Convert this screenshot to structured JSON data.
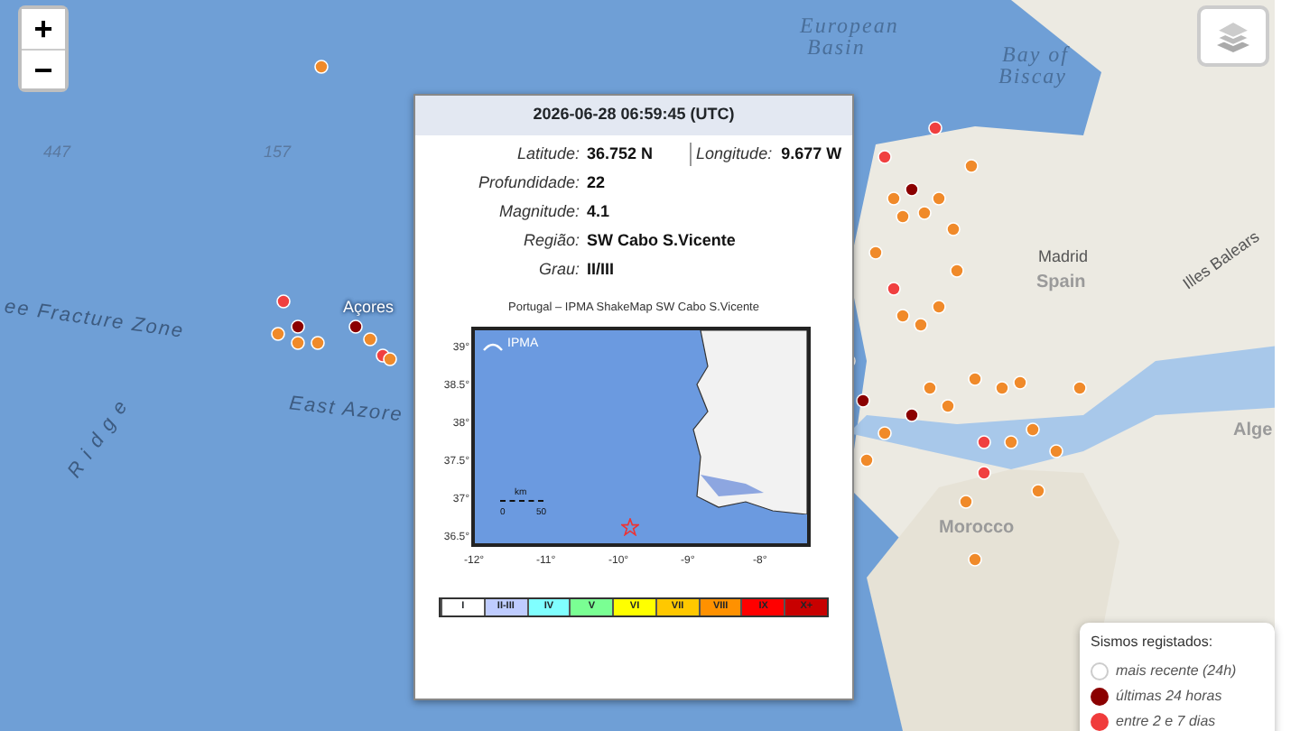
{
  "map": {
    "labels": [
      {
        "text": "European",
        "kind": "sea"
      },
      {
        "text": "Basin",
        "kind": "sea"
      },
      {
        "text": "Bay of",
        "kind": "sea"
      },
      {
        "text": "Biscay",
        "kind": "sea"
      },
      {
        "text": "447",
        "kind": "depth"
      },
      {
        "text": "157",
        "kind": "depth"
      },
      {
        "text": "ee Fracture Zone",
        "kind": "feature"
      },
      {
        "text": "R i d g e",
        "kind": "feature"
      },
      {
        "text": "East Azore",
        "kind": "feature"
      },
      {
        "text": "Açores",
        "kind": "place"
      },
      {
        "text": "Madrid",
        "kind": "place"
      },
      {
        "text": "Spain",
        "kind": "country"
      },
      {
        "text": "Illes Balears",
        "kind": "place"
      },
      {
        "text": "Morocco",
        "kind": "country"
      },
      {
        "text": "Alge",
        "kind": "country"
      }
    ]
  },
  "zoom_controls": [
    "+",
    "−"
  ],
  "popup": {
    "title": "2026-06-28 06:59:45 (UTC)",
    "rows": [
      [
        {
          "label": "Latitude:",
          "value": "36.752 N"
        },
        {
          "label": "Longitude:",
          "value": "9.677 W"
        }
      ],
      [
        {
          "label": "Profundidade:",
          "value": "22"
        }
      ],
      [
        {
          "label": "Magnitude:",
          "value": "4.1"
        }
      ],
      [
        {
          "label": "Região:",
          "value": "SW Cabo S.Vicente"
        }
      ],
      [
        {
          "label": "Grau:",
          "value": "II/III"
        }
      ]
    ],
    "shakemap": {
      "title": "Portugal – IPMA ShakeMap   SW Cabo S.Vicente",
      "logo": "IPMA",
      "lat_ticks": [
        "39°",
        "38.5°",
        "38°",
        "37.5°",
        "37°",
        "36.5°"
      ],
      "lon_ticks": [
        "-12°",
        "-11°",
        "-10°",
        "-9°",
        "-8°"
      ],
      "scale_bar": [
        "km",
        "0",
        "50"
      ],
      "scale": [
        {
          "text": "I",
          "color": "#ffffff"
        },
        {
          "text": "II-III",
          "color": "#bfccff"
        },
        {
          "text": "IV",
          "color": "#80ffff"
        },
        {
          "text": "V",
          "color": "#7aff93"
        },
        {
          "text": "VI",
          "color": "#ffff00"
        },
        {
          "text": "VII",
          "color": "#ffc800"
        },
        {
          "text": "VIII",
          "color": "#ff9100"
        },
        {
          "text": "IX",
          "color": "#ff0000"
        },
        {
          "text": "X+",
          "color": "#c80000"
        }
      ]
    }
  },
  "legend": {
    "title": "Sismos registados:",
    "items": [
      {
        "label": "mais recente (24h)",
        "color": "#ffffff"
      },
      {
        "label": "últimas 24 horas",
        "color": "#8b0000"
      },
      {
        "label": "entre 2 e 7 dias",
        "color": "#f03c3c"
      }
    ]
  }
}
